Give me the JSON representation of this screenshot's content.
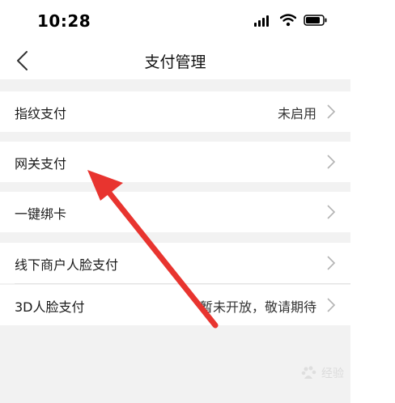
{
  "status_bar": {
    "time": "10:28"
  },
  "nav": {
    "title": "支付管理",
    "back_icon": "chevron-left-icon"
  },
  "rows": [
    {
      "label": "指纹支付",
      "value": "未启用"
    },
    {
      "label": "网关支付",
      "value": ""
    },
    {
      "label": "一键绑卡",
      "value": ""
    },
    {
      "label": "线下商户人脸支付",
      "value": ""
    },
    {
      "label": "3D人脸支付",
      "value": "暂未开放，敬请期待"
    }
  ],
  "watermark": {
    "text": "经验",
    "logo": "baidu-logo"
  },
  "colors": {
    "annotation_arrow": "#e8342f",
    "page_background": "#f2f2f2",
    "chevron": "#b3b3b3"
  }
}
